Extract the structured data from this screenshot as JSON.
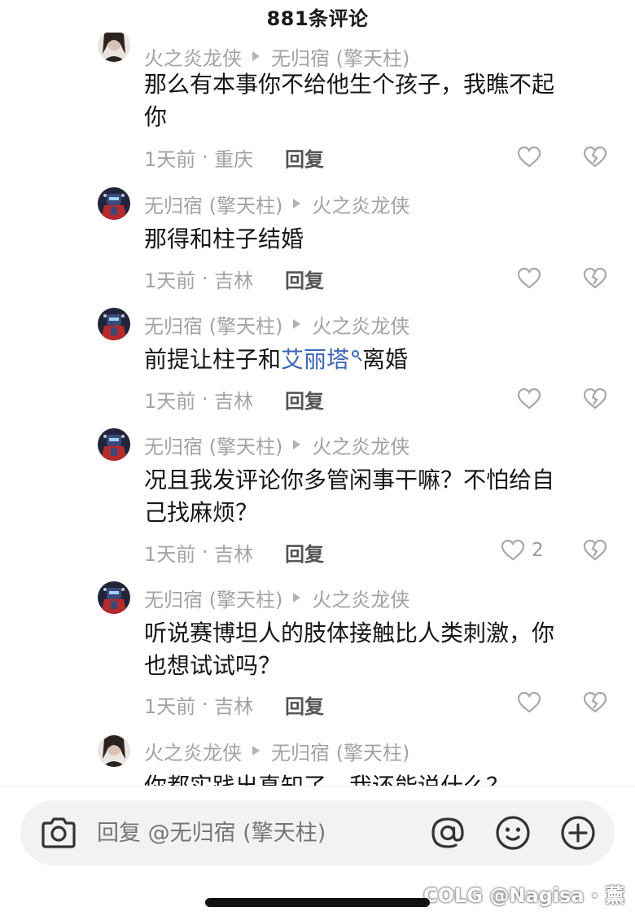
{
  "header": {
    "title": "881条评论"
  },
  "comments": [
    {
      "author": "火之炎龙侠",
      "reply_to": "无归宿 (擎天柱)",
      "avatar": "girl-avatar",
      "text_lines": [
        "那么有本事你不给他生个孩子，我瞧不起",
        "你"
      ],
      "time": "1天前",
      "location": "重庆",
      "reply_label": "回复",
      "likes": ""
    },
    {
      "author": "无归宿 (擎天柱)",
      "reply_to": "火之炎龙侠",
      "avatar": "robot-avatar",
      "text_lines": [
        "那得和柱子结婚"
      ],
      "time": "1天前",
      "location": "吉林",
      "reply_label": "回复",
      "likes": ""
    },
    {
      "author": "无归宿 (擎天柱)",
      "reply_to": "火之炎龙侠",
      "avatar": "robot-avatar",
      "text_prefix": "前提让柱子和",
      "text_link": "艾丽塔",
      "text_suffix": "离婚",
      "time": "1天前",
      "location": "吉林",
      "reply_label": "回复",
      "likes": ""
    },
    {
      "author": "无归宿 (擎天柱)",
      "reply_to": "火之炎龙侠",
      "avatar": "robot-avatar",
      "text_lines": [
        "况且我发评论你多管闲事干嘛？不怕给自",
        "己找麻烦？"
      ],
      "time": "1天前",
      "location": "吉林",
      "reply_label": "回复",
      "likes": "2"
    },
    {
      "author": "无归宿 (擎天柱)",
      "reply_to": "火之炎龙侠",
      "avatar": "robot-avatar",
      "text_lines": [
        "听说赛博坦人的肢体接触比人类刺激，你",
        "也想试试吗？"
      ],
      "time": "1天前",
      "location": "吉林",
      "reply_label": "回复",
      "likes": ""
    },
    {
      "author": "火之炎龙侠",
      "reply_to": "无归宿 (擎天柱)",
      "avatar": "girl-avatar",
      "text_lines": [
        "你都实践出真知了，我还能说什么？"
      ]
    }
  ],
  "input_bar": {
    "placeholder": "回复 @无归宿 (擎天柱)",
    "icons": [
      "camera-icon",
      "at-icon",
      "emoji-icon",
      "plus-icon"
    ]
  },
  "watermark": "COLG @Nagisa · 薰",
  "colors": {
    "link": "#3a66b6",
    "meta": "#a3a3a3",
    "text": "#161616",
    "input_bg": "#f2f2f3"
  }
}
